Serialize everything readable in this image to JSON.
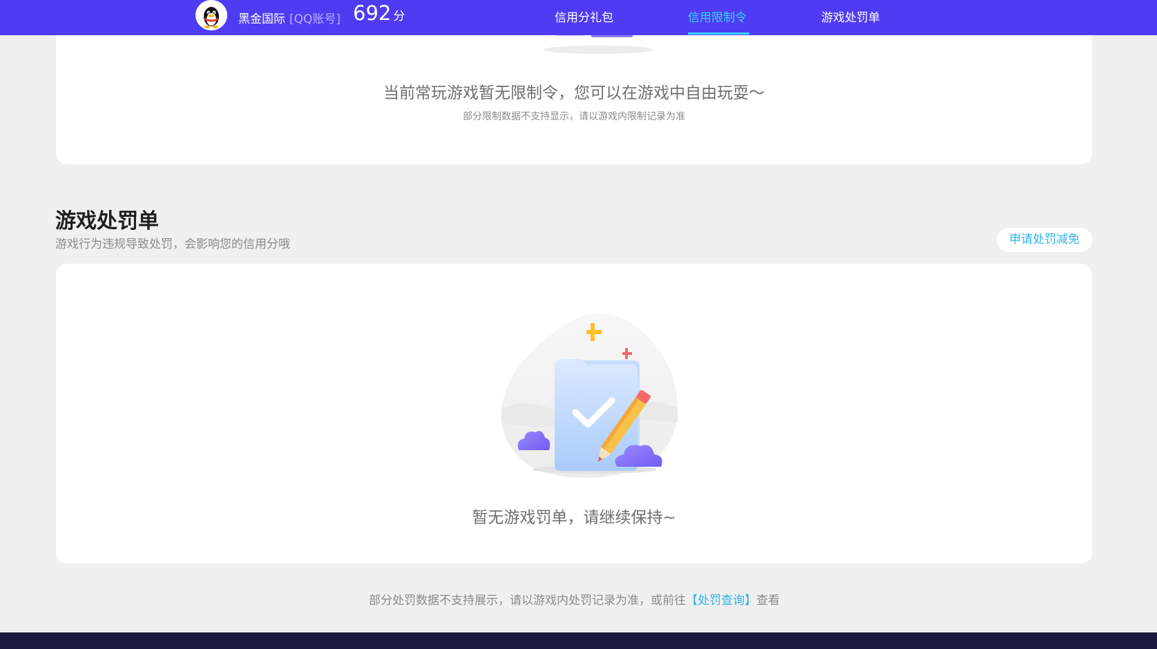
{
  "header": {
    "username": "黑金国际",
    "account_type": "[QQ账号]",
    "score": "692",
    "score_unit": "分",
    "tabs": [
      {
        "label": "信用分礼包"
      },
      {
        "label": "信用限制令"
      },
      {
        "label": "游戏处罚单"
      }
    ],
    "active_tab": 1,
    "avatar_icon": "qq-penguin-icon"
  },
  "restriction_card": {
    "message": "当前常玩游戏暂无限制令，您可以在游戏中自由玩耍～",
    "note": "部分限制数据不支持显示，请以游戏内限制记录为准"
  },
  "penalty_section": {
    "title": "游戏处罚单",
    "description": "游戏行为违规导致处罚，会影响您的信用分哦",
    "appeal_button": "申请处罚减免",
    "empty_message": "暂无游戏罚单，请继续保持~",
    "illustration_icon": "empty-folder-pencil-icon"
  },
  "footer": {
    "note_prefix": "部分处罚数据不支持展示，请以游戏内处罚记录为准，或前往",
    "link_text": "【处罚查询】",
    "note_suffix": "查看"
  },
  "colors": {
    "header_bg": "#4f3cf2",
    "active_tab": "#35d4ff",
    "link": "#2cb4e8",
    "page_bg": "#f0f0f0",
    "bottom_bar": "#1c1c40"
  }
}
